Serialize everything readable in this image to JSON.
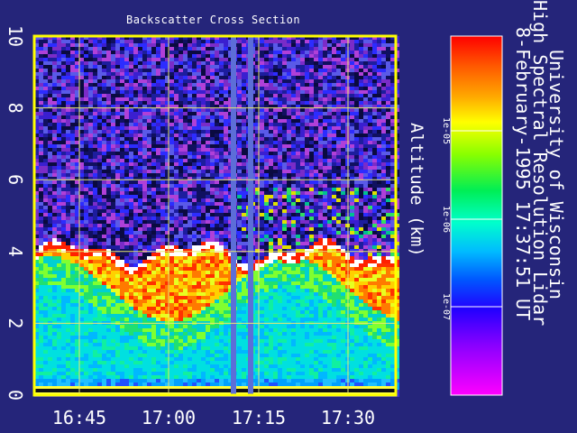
{
  "chart_data": {
    "type": "heatmap",
    "title": "Backscatter Cross Section",
    "ylabel": "Altitude (km)",
    "y_ticks": [
      "0",
      "2",
      "4",
      "6",
      "8",
      "10"
    ],
    "ylim": [
      0,
      10
    ],
    "x_ticks": [
      "16:45",
      "17:00",
      "17:15",
      "17:30"
    ],
    "grid": true,
    "colorbar": {
      "scale": "log",
      "ticks": [
        "1e-05",
        "1e-06",
        "1e-07"
      ],
      "colors": [
        "#ff0000",
        "#ff8800",
        "#ffff00",
        "#88ff00",
        "#00ee66",
        "#00ffff",
        "#0088ff",
        "#0000ff",
        "#8800ff",
        "#ff00ff"
      ]
    },
    "annotation": {
      "line1": "University of Wisconsin",
      "line2": "High Spectral Resolution Lidar",
      "line3": "8-February-1995 17:37:51 UT"
    }
  },
  "colors": {
    "background": "#25257a",
    "frame": "#ffff00",
    "grid": "#e8e870",
    "gap": "#5c6ed8",
    "text": "#ffffff"
  }
}
